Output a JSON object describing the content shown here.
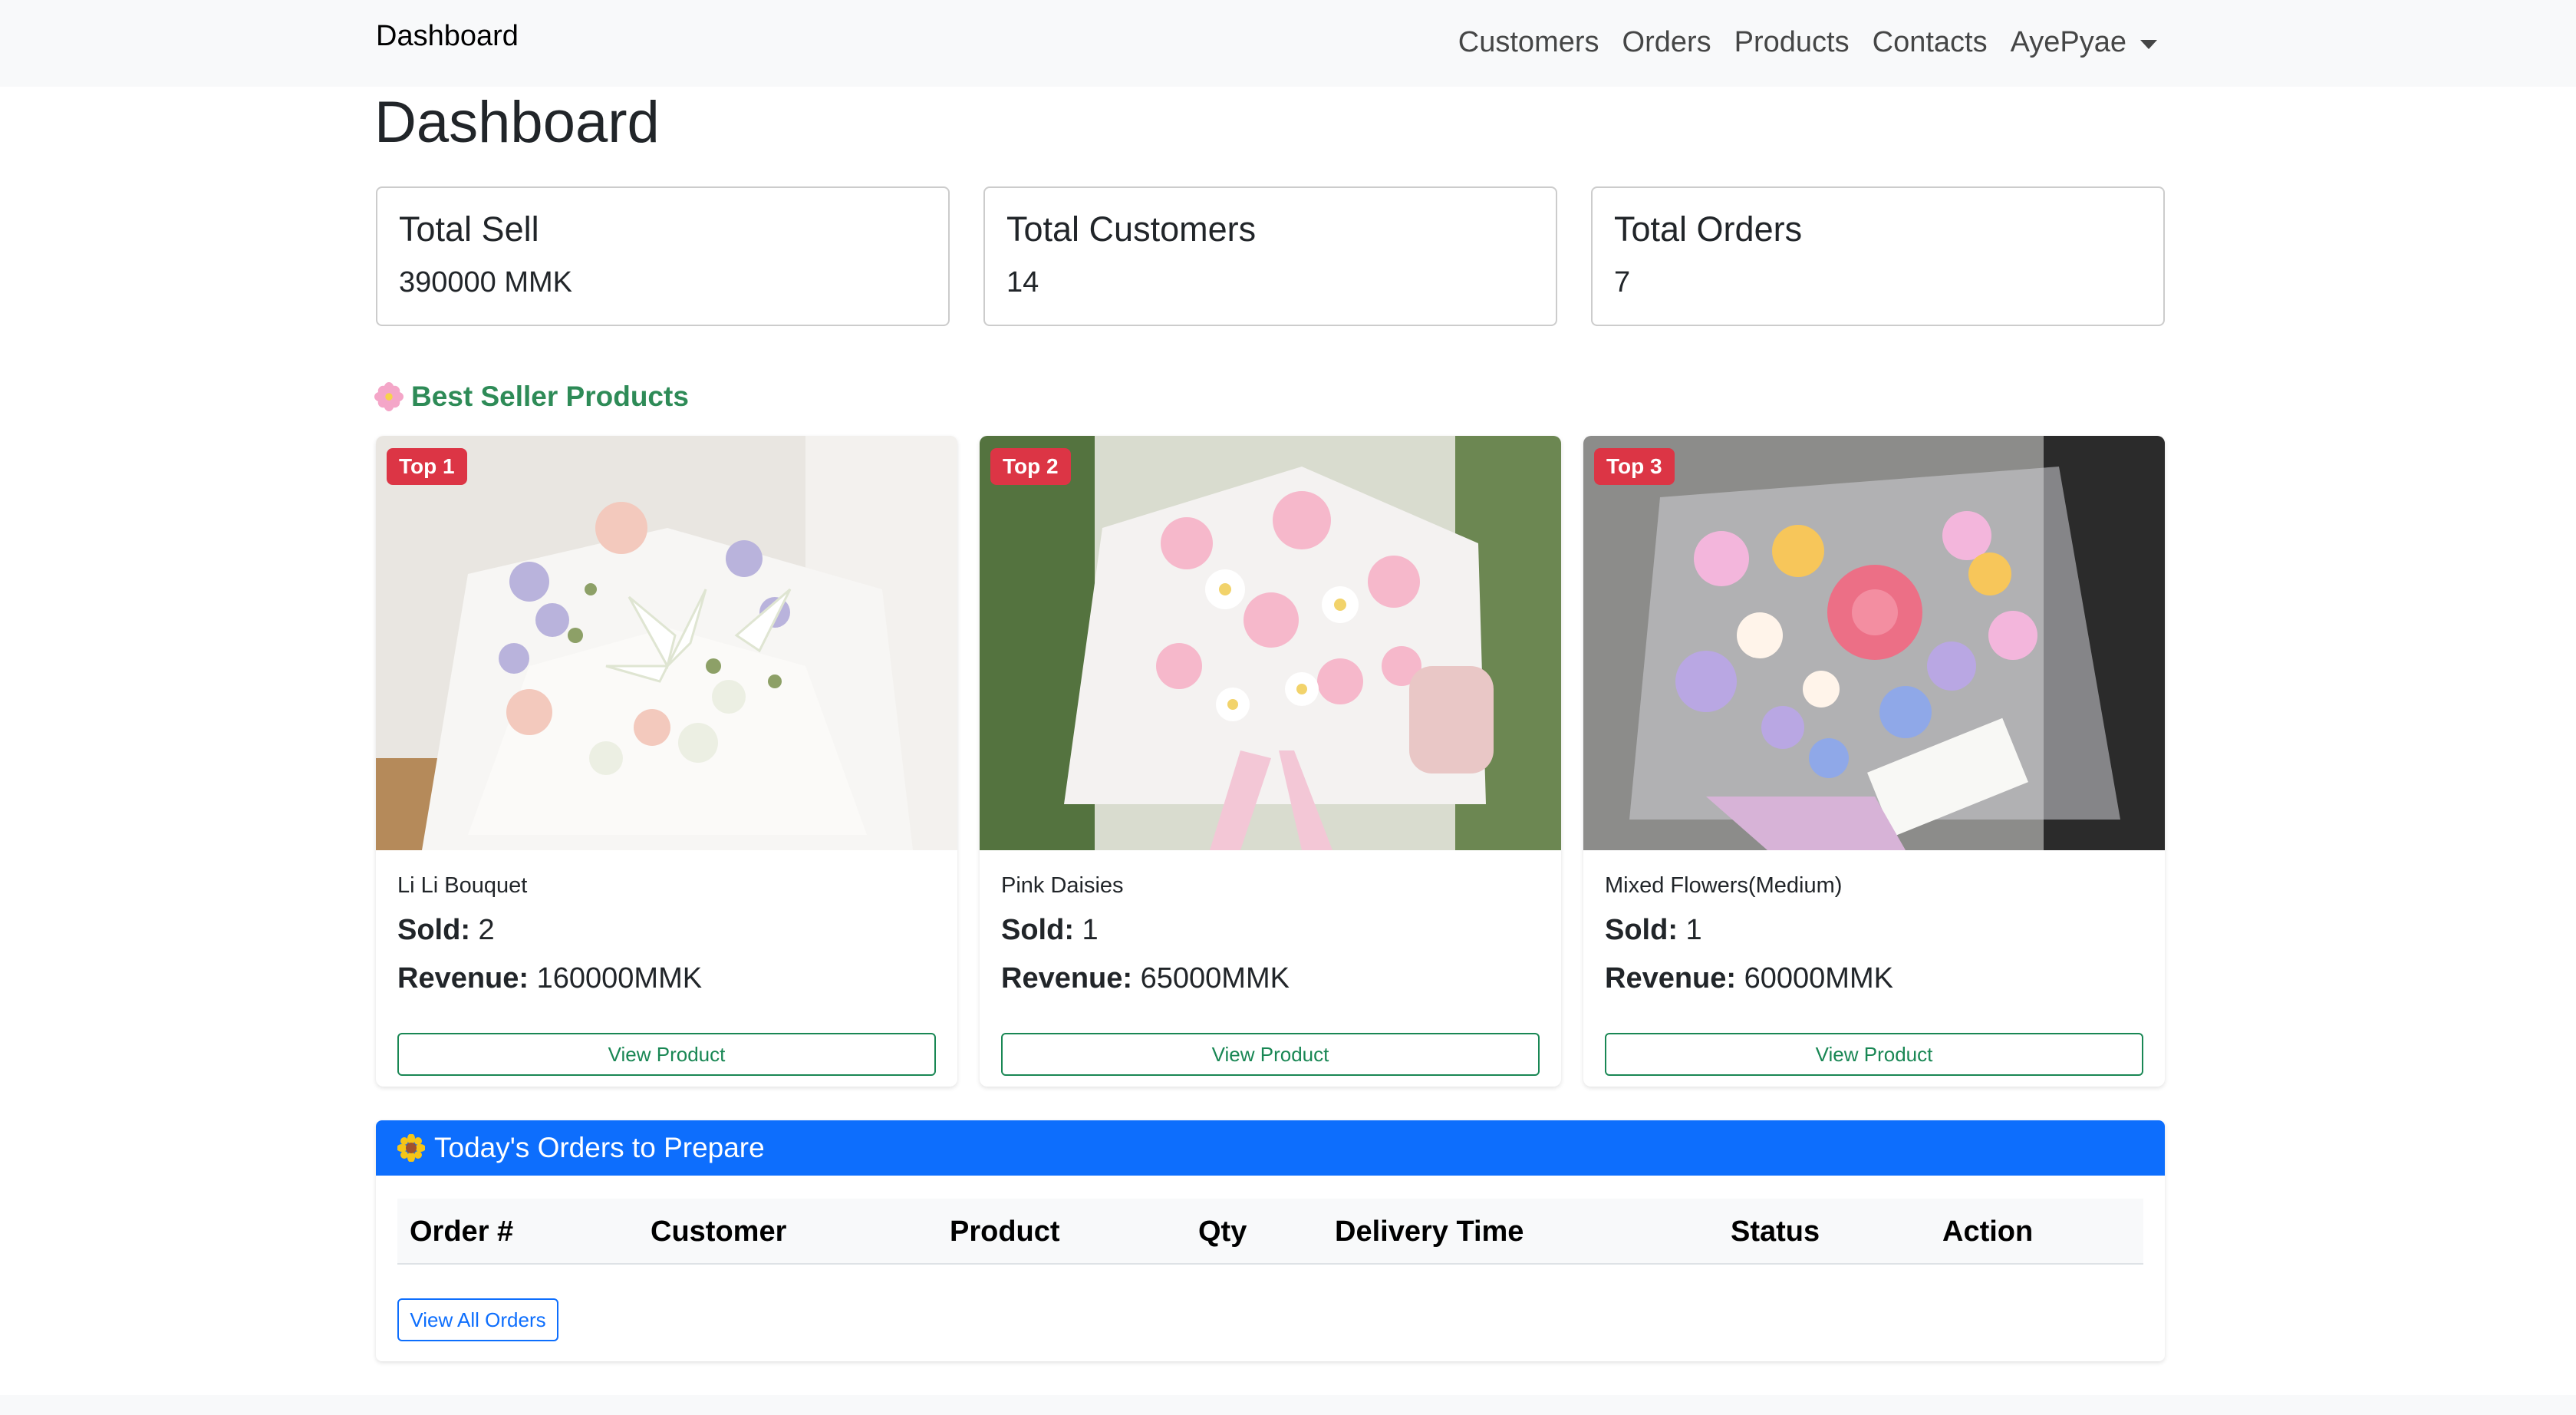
{
  "navbar": {
    "brand": "Dashboard",
    "links": [
      "Customers",
      "Orders",
      "Products",
      "Contacts"
    ],
    "user": "AyePyae"
  },
  "page_title": "Dashboard",
  "stats": [
    {
      "title": "Total Sell",
      "value": "390000 MMK"
    },
    {
      "title": "Total Customers",
      "value": "14"
    },
    {
      "title": "Total Orders",
      "value": "7"
    }
  ],
  "best_sellers": {
    "title": "Best Seller Products",
    "icon": "blossom-icon",
    "products": [
      {
        "badge": "Top 1",
        "name": "Li Li Bouquet",
        "sold_label": "Sold:",
        "sold": "2",
        "revenue_label": "Revenue:",
        "revenue": "160000MMK",
        "button": "View Product"
      },
      {
        "badge": "Top 2",
        "name": "Pink Daisies",
        "sold_label": "Sold:",
        "sold": "1",
        "revenue_label": "Revenue:",
        "revenue": "65000MMK",
        "button": "View Product"
      },
      {
        "badge": "Top 3",
        "name": "Mixed Flowers(Medium)",
        "sold_label": "Sold:",
        "sold": "1",
        "revenue_label": "Revenue:",
        "revenue": "60000MMK",
        "button": "View Product"
      }
    ]
  },
  "orders": {
    "title": "Today's Orders to Prepare",
    "icon": "sunflower-icon",
    "columns": [
      "Order #",
      "Customer",
      "Product",
      "Qty",
      "Delivery Time",
      "Status",
      "Action"
    ],
    "view_all": "View All Orders"
  },
  "colors": {
    "navbar_bg": "#f8f9fa",
    "section_green": "#2e8b57",
    "badge_red": "#dc3545",
    "header_blue": "#0d6efd",
    "button_green": "#198754"
  }
}
